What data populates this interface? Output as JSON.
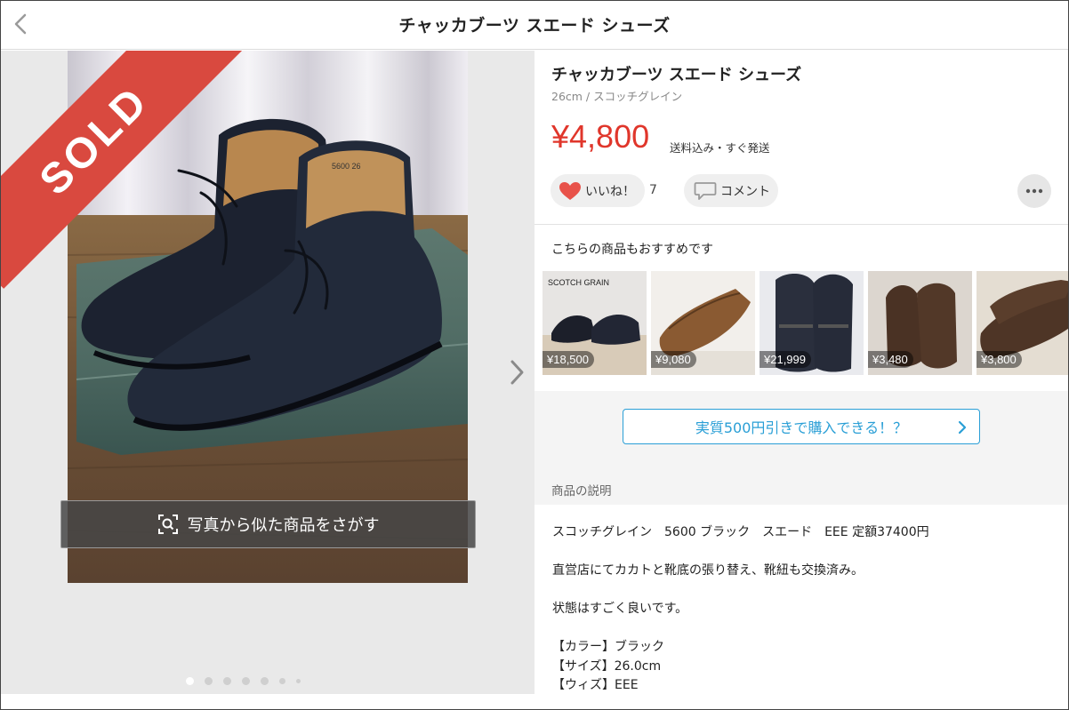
{
  "nav": {
    "title": "チャッカブーツ スエード シューズ"
  },
  "gallery": {
    "sold_label": "SOLD",
    "search_by_photo_label": "写真から似た商品をさがす",
    "box_label": "5600 26"
  },
  "item": {
    "title": "チャッカブーツ スエード シューズ",
    "subtitle": "26cm / スコッチグレイン",
    "price": "¥4,800",
    "price_note": "送料込み・すぐ発送",
    "like_label": "いいね！",
    "like_count": "7",
    "comment_label": "コメント"
  },
  "recommend": {
    "title": "こちらの商品もおすすめです",
    "items": [
      {
        "price": "¥18,500",
        "caption": "SCOTCH GRAIN"
      },
      {
        "price": "¥9,080",
        "caption": ""
      },
      {
        "price": "¥21,999",
        "caption": ""
      },
      {
        "price": "¥3,480",
        "caption": ""
      },
      {
        "price": "¥3,800",
        "caption": ""
      }
    ]
  },
  "promo": {
    "label": "実質500円引きで購入できる！？"
  },
  "description": {
    "heading": "商品の説明",
    "lines": [
      "スコッチグレイン　5600 ブラック　スエード　EEE 定額37400円",
      "",
      "直営店にてカカトと靴底の張り替え、靴紐も交換済み。",
      "",
      "状態はすごく良いです。",
      "",
      "【カラー】ブラック",
      "【サイズ】26.0cm",
      "【ウィズ】EEE"
    ]
  },
  "colors": {
    "price_red": "#e0362b",
    "sold_red": "#d9493f",
    "link_blue": "#2a9fd6",
    "heart_red": "#e8524a"
  },
  "icons": [
    "back-chevron-icon",
    "scan-search-icon",
    "next-chevron-icon",
    "heart-icon",
    "comment-bubble-icon",
    "more-dots-icon",
    "chevron-right-icon"
  ]
}
